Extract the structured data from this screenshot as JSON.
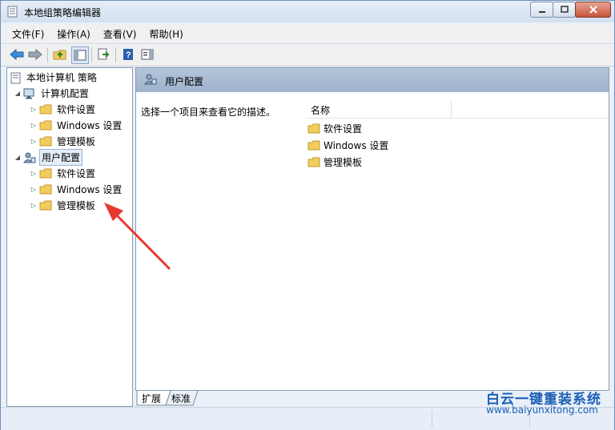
{
  "window": {
    "title": "本地组策略编辑器"
  },
  "menu": [
    {
      "label": "文件(F)"
    },
    {
      "label": "操作(A)"
    },
    {
      "label": "查看(V)"
    },
    {
      "label": "帮助(H)"
    }
  ],
  "tree": {
    "root": "本地计算机 策略",
    "computer_config": "计算机配置",
    "user_config": "用户配置",
    "software_settings": "软件设置",
    "windows_settings": "Windows 设置",
    "admin_templates": "管理模板"
  },
  "right_pane": {
    "header": "用户配置",
    "description": "选择一个项目来查看它的描述。",
    "column_name": "名称",
    "items": [
      "软件设置",
      "Windows 设置",
      "管理模板"
    ]
  },
  "tabs": [
    "扩展",
    "标准"
  ],
  "watermark": {
    "brand": "白云一键重装系统",
    "url": "www.baiyunxitong.com"
  },
  "colors": {
    "folder": "#f2cc5c",
    "header": "#a9bdd5",
    "arrow": "#e8392e"
  }
}
